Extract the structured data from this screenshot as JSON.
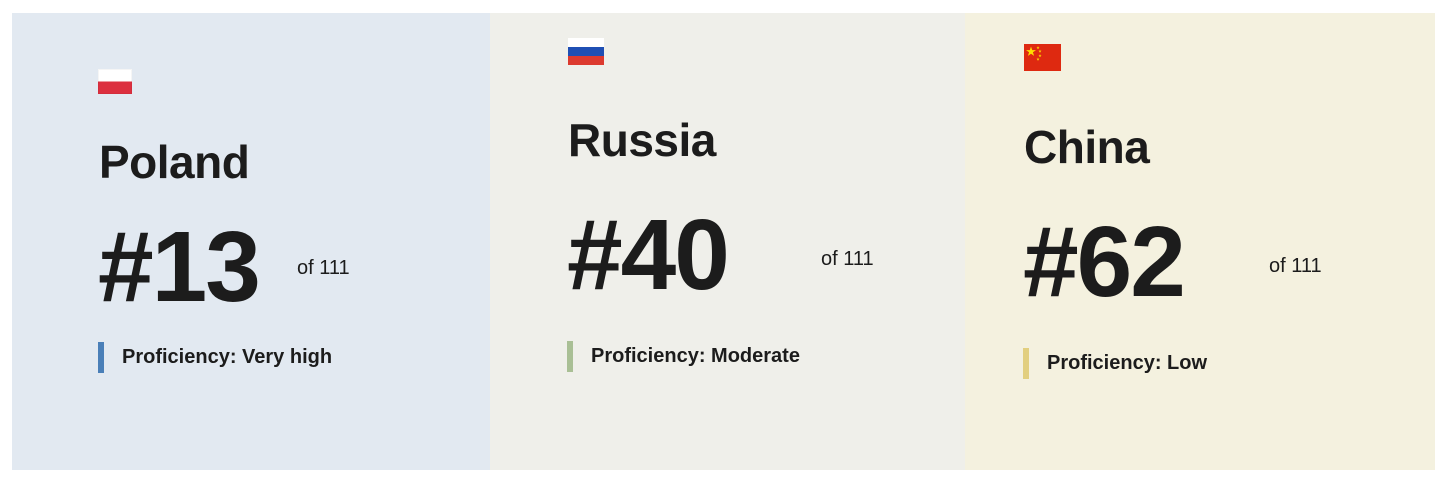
{
  "cards": [
    {
      "flag_icon": "poland-flag-icon",
      "country": "Poland",
      "rank": "#13",
      "of_total": "of 111",
      "proficiency_label": "Proficiency: Very high",
      "background": "#e2e9f1",
      "accent": "#4a7fb8"
    },
    {
      "flag_icon": "russia-flag-icon",
      "country": "Russia",
      "rank": "#40",
      "of_total": "of 111",
      "proficiency_label": "Proficiency: Moderate",
      "background": "#efefea",
      "accent": "#a9bf95"
    },
    {
      "flag_icon": "china-flag-icon",
      "country": "China",
      "rank": "#62",
      "of_total": "of 111",
      "proficiency_label": "Proficiency: Low",
      "background": "#f4f1df",
      "accent": "#e2cf7f"
    }
  ]
}
